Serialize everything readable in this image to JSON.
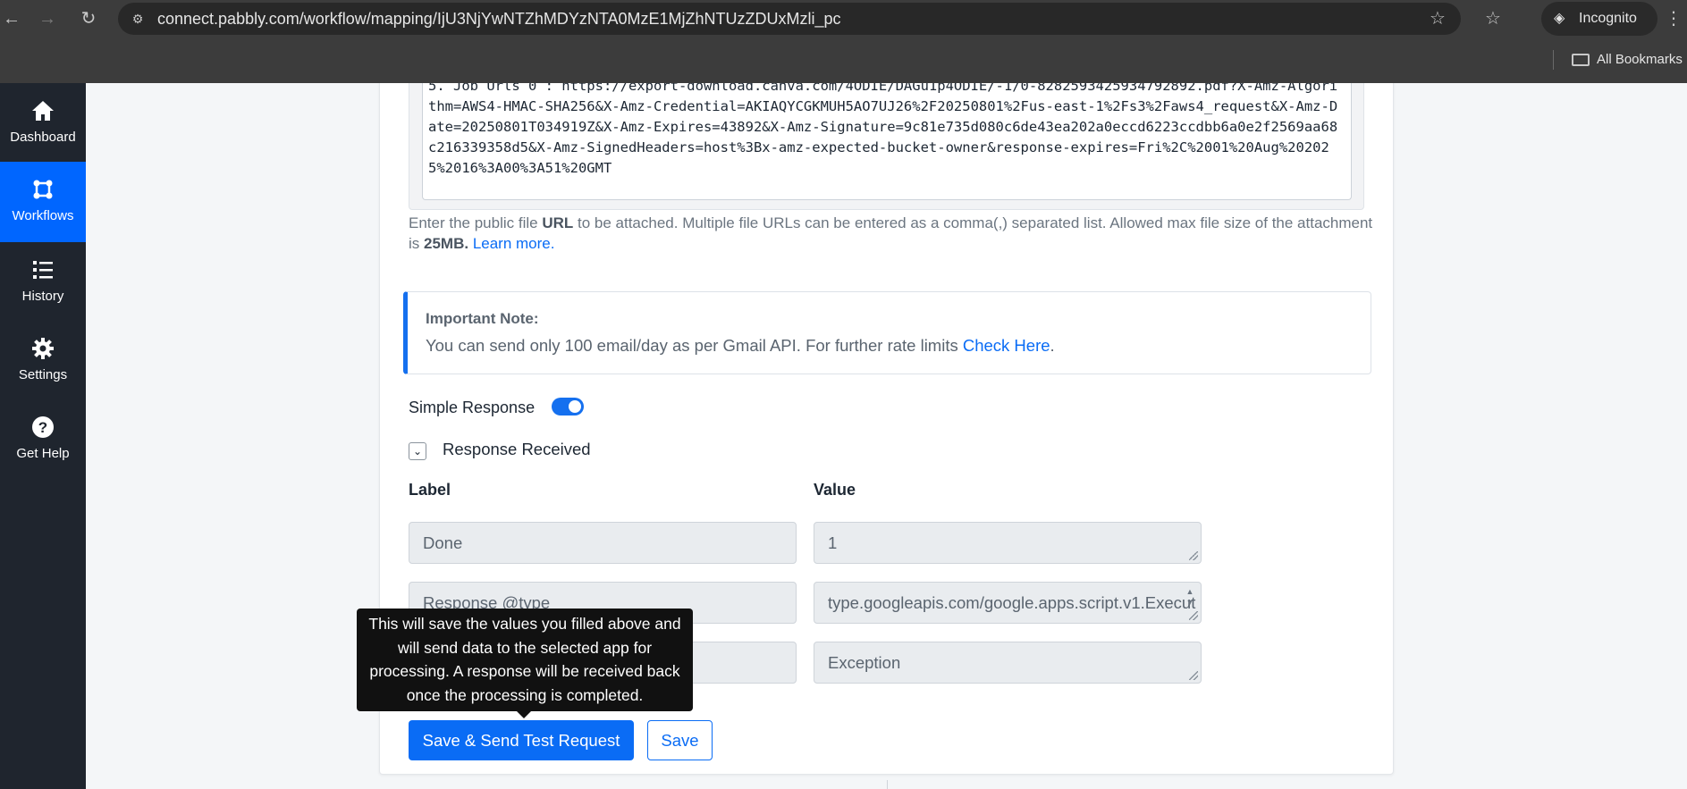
{
  "browser": {
    "url": "connect.pabbly.com/workflow/mapping/IjU3NjYwNTZhMDYzNTA0MzE1MjZhNTUzZDUxMzli_pc",
    "incognito_label": "Incognito",
    "bookmarks_label": "All Bookmarks"
  },
  "sidebar": {
    "items": [
      {
        "label": "Dashboard",
        "icon": "home-icon"
      },
      {
        "label": "Workflows",
        "icon": "workflow-icon"
      },
      {
        "label": "History",
        "icon": "list-icon"
      },
      {
        "label": "Settings",
        "icon": "gear-icon"
      },
      {
        "label": "Get Help",
        "icon": "question-icon"
      }
    ],
    "active_index": 1
  },
  "attachment": {
    "url_value": "5. Job Urls 0 : https://export-download.canva.com/4ODIE/DAGu1p4ODIE/-1/0-8282593425934792892.pdf?X-Amz-Algorithm=AWS4-HMAC-SHA256&X-Amz-Credential=AKIAQYCGKMUH5AO7UJ26%2F20250801%2Fus-east-1%2Fs3%2Faws4_request&X-Amz-Date=20250801T034919Z&X-Amz-Expires=43892&X-Amz-Signature=9c81e735d080c6de43ea202a0eccd6223ccdbb6a0e2f2569aa68c216339358d5&X-Amz-SignedHeaders=host%3Bx-amz-expected-bucket-owner&response-expires=Fri%2C%2001%20Aug%202025%2016%3A00%3A51%20GMT",
    "help_pre": "Enter the public file ",
    "help_url": "URL",
    "help_mid": " to be attached. Multiple file URLs can be entered as a comma(,) separated list. Allowed max file size of the attachment is ",
    "help_size": "25MB.",
    "help_link": "Learn more."
  },
  "note": {
    "title": "Important Note:",
    "body": "You can send only 100 email/day as per Gmail API. For further rate limits ",
    "link": "Check Here",
    "suffix": "."
  },
  "simple_response": {
    "label": "Simple Response",
    "enabled": true
  },
  "response": {
    "section_label": "Response Received",
    "label_header": "Label",
    "value_header": "Value",
    "rows": [
      {
        "label": "Done",
        "value": "1"
      },
      {
        "label": "Response @type",
        "value": "type.googleapis.com/google.apps.script.v1.Execut"
      },
      {
        "label": "",
        "value": "Exception"
      }
    ]
  },
  "tooltip": {
    "text": "This will save the values you filled above and will send data to the selected app for processing. A response will be received back once the processing is completed."
  },
  "buttons": {
    "send_test": "Save & Send Test Request",
    "save": "Save"
  },
  "colors": {
    "accent": "#0a6cf5",
    "sidebar_bg": "#1f252e",
    "sidebar_active": "#0066ff"
  }
}
